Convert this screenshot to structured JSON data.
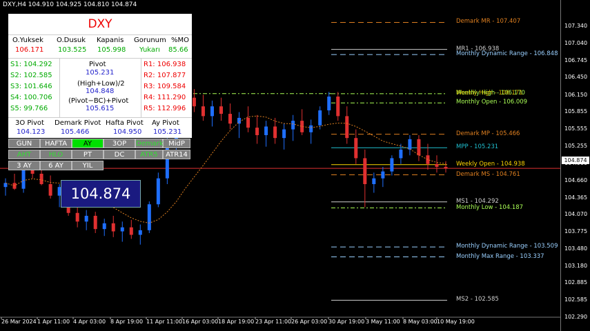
{
  "header": "DXY,H4  104.910 104.925 104.810 104.874",
  "panel": {
    "title": "DXY",
    "stats_headers": [
      "O.Yuksek",
      "O.Dusuk",
      "Kapanis",
      "Gorunum",
      "%MO"
    ],
    "stats_values": [
      "106.171",
      "103.525",
      "105.998",
      "Yukarı",
      "85.66"
    ],
    "supports": [
      "S1: 104.292",
      "S2: 102.585",
      "S3: 101.646",
      "S4: 100.706",
      "S5: 99.766"
    ],
    "resistances": [
      "R1: 106.938",
      "R2: 107.877",
      "R3: 109.584",
      "R4: 111.290",
      "R5: 112.996"
    ],
    "pivot_label": "Pivot",
    "pivot_value": "105.231",
    "hl2_label": "(High+Low)/2",
    "hl2_value": "104.848",
    "bc_label": "(Pivot−BC)+Pivot",
    "bc_value": "105.615",
    "bottom_headers": [
      "3O Pivot",
      "Demark Pivot",
      "Hafta Pivot",
      "Ay Pivot"
    ],
    "bottom_values": [
      "104.123",
      "105.466",
      "104.950",
      "105.231"
    ]
  },
  "buttons": {
    "row1": [
      "GUN",
      "HAFTA",
      "AY",
      "3OP",
      "Demark",
      "MidP"
    ],
    "row2": [
      "AHT",
      "HLO",
      "PT",
      "DC",
      "ATR5",
      "ATR14"
    ],
    "row3": [
      "3 AY",
      "6 AY",
      "YIL"
    ]
  },
  "price_box": "104.874",
  "current_price_tag": "104.874",
  "colors": {
    "up": "#1f6fff",
    "down": "#e03030",
    "background": "#000000"
  },
  "chart_data": {
    "type": "candlestick",
    "symbol": "DXY",
    "timeframe": "H4",
    "ylim": [
      102.29,
      107.7
    ],
    "y_ticks": [
      "107.340",
      "107.040",
      "106.745",
      "106.450",
      "106.150",
      "105.855",
      "105.555",
      "105.255",
      "104.960",
      "104.660",
      "104.365",
      "104.070",
      "103.775",
      "103.480",
      "103.180",
      "102.885",
      "102.585",
      "102.290"
    ],
    "x_ticks": [
      "26 Mar 2024",
      "1 Apr 11:00",
      "4 Apr 03:00",
      "8 Apr 19:00",
      "11 Apr 11:00",
      "16 Apr 03:00",
      "18 Apr 19:00",
      "23 Apr 11:00",
      "26 Apr 03:00",
      "30 Apr 19:00",
      "3 May 11:00",
      "8 May 03:00",
      "10 May 19:00"
    ],
    "levels": [
      {
        "name": "Demark MR - 107.407",
        "value": 107.407,
        "color": "#e08020",
        "style": "dash"
      },
      {
        "name": "MR1 - 106.938",
        "value": 106.938,
        "color": "#d0d0d0",
        "style": "solid"
      },
      {
        "name": "Monthly Dynamic Range - 106.848",
        "value": 106.848,
        "color": "#9ad0ff",
        "style": "dash"
      },
      {
        "name": "Monthly High - 106.170",
        "value": 106.17,
        "color": "#aaff55",
        "style": "dashdot"
      },
      {
        "name": "Monthly Open - 106.009",
        "value": 106.009,
        "color": "#aaff55",
        "style": "dashdot"
      },
      {
        "name": "Demark MP - 105.466",
        "value": 105.466,
        "color": "#e08020",
        "style": "dash"
      },
      {
        "name": "MPP - 105.231",
        "value": 105.231,
        "color": "#20c0d0",
        "style": "solid"
      },
      {
        "name": "Weekly Open - 104.938",
        "value": 104.938,
        "color": "#ffd700",
        "style": "solid"
      },
      {
        "name": "Demark MS - 104.761",
        "value": 104.761,
        "color": "#e08020",
        "style": "dash"
      },
      {
        "name": "MS1 - 104.292",
        "value": 104.292,
        "color": "#d0d0d0",
        "style": "solid"
      },
      {
        "name": "Monthly Low - 104.187",
        "value": 104.187,
        "color": "#aaff55",
        "style": "dashdot"
      },
      {
        "name": "Monthly Dynamic Range - 103.509",
        "value": 103.509,
        "color": "#9ad0ff",
        "style": "dash"
      },
      {
        "name": "Monthly Max Range - 103.337",
        "value": 103.337,
        "color": "#9ad0ff",
        "style": "dash"
      },
      {
        "name": "MS2 - 102.585",
        "value": 102.585,
        "color": "#d0d0d0",
        "style": "solid"
      }
    ],
    "overlapping_label": "Weekly High - 106.171",
    "candles": [
      [
        0,
        104.55,
        104.7,
        104.4,
        104.62
      ],
      [
        1,
        104.62,
        104.78,
        104.5,
        104.52
      ],
      [
        2,
        104.52,
        104.9,
        104.45,
        104.85
      ],
      [
        3,
        104.85,
        105.0,
        104.7,
        104.78
      ],
      [
        4,
        104.78,
        104.92,
        104.58,
        104.6
      ],
      [
        5,
        104.6,
        104.75,
        104.35,
        104.4
      ],
      [
        6,
        104.4,
        104.6,
        104.2,
        104.55
      ],
      [
        7,
        104.55,
        104.62,
        104.05,
        104.1
      ],
      [
        8,
        104.1,
        104.25,
        103.85,
        103.95
      ],
      [
        9,
        103.95,
        104.15,
        103.8,
        104.05
      ],
      [
        10,
        104.05,
        104.12,
        103.75,
        103.82
      ],
      [
        11,
        103.82,
        104.0,
        103.7,
        103.92
      ],
      [
        12,
        103.92,
        104.05,
        103.68,
        103.78
      ],
      [
        13,
        103.78,
        103.95,
        103.6,
        103.85
      ],
      [
        14,
        103.85,
        103.98,
        103.65,
        103.72
      ],
      [
        15,
        103.72,
        103.9,
        103.55,
        103.8
      ],
      [
        16,
        103.8,
        104.3,
        103.75,
        104.25
      ],
      [
        17,
        104.25,
        104.8,
        104.2,
        104.7
      ],
      [
        18,
        104.7,
        105.4,
        104.6,
        105.3
      ],
      [
        19,
        105.3,
        105.9,
        105.2,
        105.8
      ],
      [
        20,
        105.8,
        106.2,
        105.7,
        106.1
      ],
      [
        21,
        106.1,
        106.25,
        105.85,
        105.95
      ],
      [
        22,
        105.95,
        106.15,
        105.7,
        105.78
      ],
      [
        23,
        105.78,
        106.05,
        105.6,
        105.95
      ],
      [
        24,
        105.95,
        106.1,
        105.7,
        105.82
      ],
      [
        25,
        105.82,
        106.0,
        105.55,
        105.65
      ],
      [
        26,
        105.65,
        105.85,
        105.4,
        105.75
      ],
      [
        27,
        105.75,
        105.95,
        105.5,
        105.58
      ],
      [
        28,
        105.58,
        105.8,
        105.3,
        105.45
      ],
      [
        29,
        105.45,
        105.7,
        105.25,
        105.6
      ],
      [
        30,
        105.6,
        105.75,
        105.3,
        105.4
      ],
      [
        31,
        105.4,
        105.65,
        105.2,
        105.55
      ],
      [
        32,
        105.55,
        105.8,
        105.35,
        105.7
      ],
      [
        33,
        105.7,
        105.9,
        105.45,
        105.5
      ],
      [
        34,
        105.5,
        105.72,
        105.3,
        105.62
      ],
      [
        35,
        105.62,
        105.95,
        105.55,
        105.88
      ],
      [
        36,
        105.88,
        106.2,
        105.8,
        106.12
      ],
      [
        37,
        106.12,
        106.2,
        105.7,
        105.78
      ],
      [
        38,
        105.78,
        105.95,
        105.3,
        105.4
      ],
      [
        39,
        105.4,
        105.55,
        104.95,
        105.05
      ],
      [
        40,
        105.05,
        105.2,
        104.2,
        104.6
      ],
      [
        41,
        104.6,
        104.8,
        104.45,
        104.7
      ],
      [
        42,
        104.7,
        104.9,
        104.55,
        104.82
      ],
      [
        43,
        104.82,
        105.1,
        104.75,
        105.05
      ],
      [
        44,
        105.05,
        105.3,
        104.95,
        105.2
      ],
      [
        45,
        105.2,
        105.45,
        105.1,
        105.38
      ],
      [
        46,
        105.38,
        105.45,
        105.0,
        105.1
      ],
      [
        47,
        105.1,
        105.3,
        104.85,
        104.95
      ],
      [
        48,
        104.95,
        105.1,
        104.8,
        104.9
      ],
      [
        49,
        104.9,
        105.0,
        104.8,
        104.874
      ]
    ]
  }
}
